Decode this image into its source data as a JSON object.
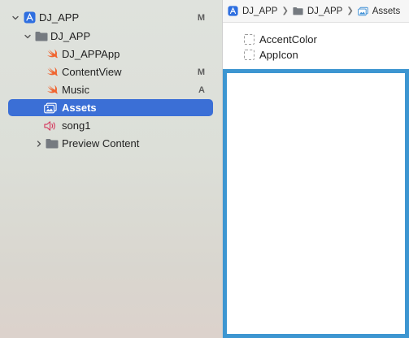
{
  "navigator": {
    "items": [
      {
        "label": "DJ_APP",
        "badge": "M",
        "icon": "app-project-icon"
      },
      {
        "label": "DJ_APP",
        "badge": "",
        "icon": "folder-icon"
      },
      {
        "label": "DJ_APPApp",
        "badge": "",
        "icon": "swift-file-icon"
      },
      {
        "label": "ContentView",
        "badge": "M",
        "icon": "swift-file-icon"
      },
      {
        "label": "Music",
        "badge": "A",
        "icon": "swift-file-icon"
      },
      {
        "label": "Assets",
        "badge": "",
        "icon": "asset-catalog-icon"
      },
      {
        "label": "song1",
        "badge": "",
        "icon": "audio-file-icon"
      },
      {
        "label": "Preview Content",
        "badge": "",
        "icon": "folder-icon"
      }
    ]
  },
  "jumpbar": {
    "crumbs": [
      "DJ_APP",
      "DJ_APP",
      "Assets"
    ]
  },
  "assets": {
    "items": [
      "AccentColor",
      "AppIcon"
    ]
  },
  "colors": {
    "selection": "#3b6fd6",
    "swift": "#f0642f",
    "canvas_border": "#3d96d1"
  }
}
